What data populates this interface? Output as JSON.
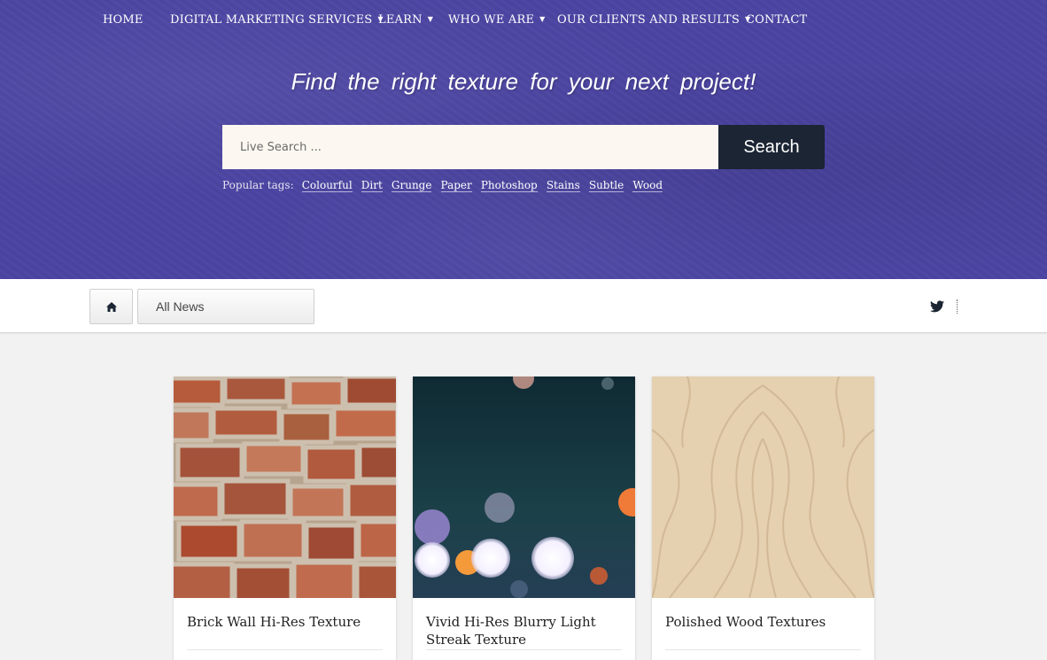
{
  "nav": {
    "items": [
      {
        "label": "HOME",
        "has_dropdown": false
      },
      {
        "label": "DIGITAL MARKETING SERVICES",
        "has_dropdown": true
      },
      {
        "label": "LEARN",
        "has_dropdown": true
      },
      {
        "label": "WHO WE ARE",
        "has_dropdown": true
      },
      {
        "label": "OUR CLIENTS AND RESULTS",
        "has_dropdown": true
      },
      {
        "label": "CONTACT",
        "has_dropdown": false
      }
    ]
  },
  "hero": {
    "tagline": "Find the right texture for your next project!",
    "search": {
      "placeholder": "Live Search ...",
      "value": "",
      "button_label": "Search"
    },
    "popular_tags_label": "Popular tags:",
    "tags": [
      "Colourful",
      "Dirt",
      "Grunge",
      "Paper",
      "Photoshop",
      "Stains",
      "Subtle",
      "Wood"
    ],
    "background_color": "#4b44a2"
  },
  "toolbar": {
    "home_icon": "home-icon",
    "filter_label": "All News",
    "social_icon": "twitter-icon"
  },
  "cards": [
    {
      "title": "Brick Wall Hi-Res Texture",
      "image": "brick-wall-texture"
    },
    {
      "title": "Vivid Hi-Res Blurry Light Streak Texture",
      "image": "blurry-light-bokeh"
    },
    {
      "title": "Polished Wood Textures",
      "image": "polished-wood-texture"
    }
  ],
  "colors": {
    "search_button": "#1b2533",
    "search_input_bg": "#fcf8f1",
    "page_bg": "#f2f2f2"
  }
}
